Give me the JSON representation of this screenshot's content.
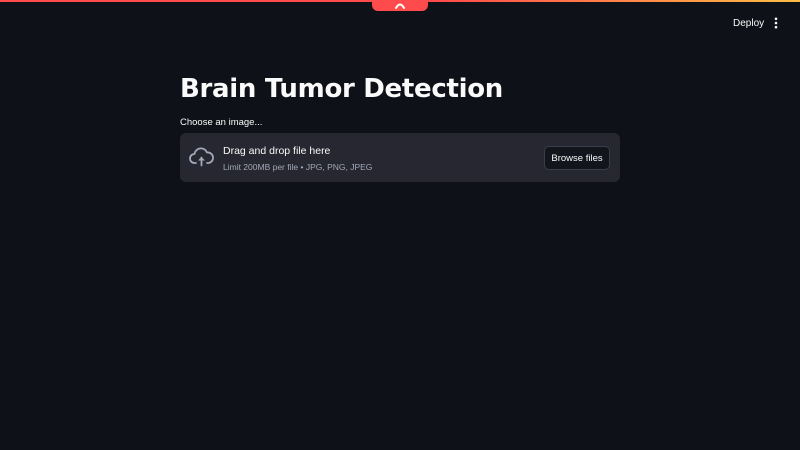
{
  "header": {
    "deploy_label": "Deploy",
    "menu_icon": "more-vertical-icon",
    "tab_icon": "chevron-up-icon"
  },
  "main": {
    "title": "Brain Tumor Detection",
    "uploader": {
      "label": "Choose an image...",
      "icon": "cloud-upload-icon",
      "dropzone_title": "Drag and drop file here",
      "dropzone_hint": "Limit 200MB per file • JPG, PNG, JPEG",
      "browse_label": "Browse files"
    }
  },
  "colors": {
    "background": "#0e1117",
    "accent": "#ff4b4b",
    "accent_secondary": "#ffbd45",
    "dropzone_bg": "#262730",
    "text": "#fafafa",
    "muted_text": "#a3a8b8"
  }
}
